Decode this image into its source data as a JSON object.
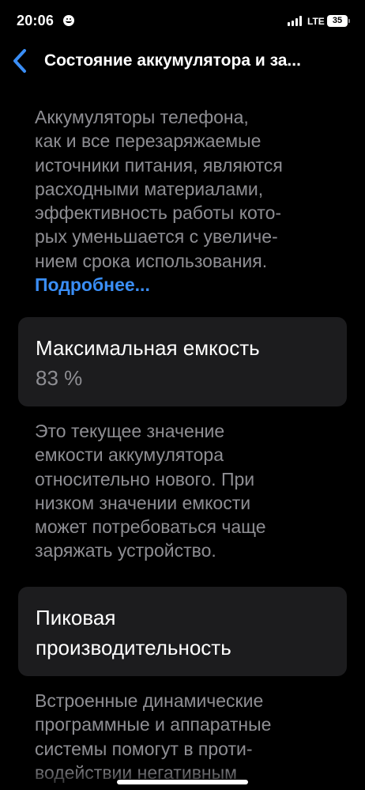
{
  "status_bar": {
    "time": "20:06",
    "network": "LTE",
    "battery_level": "35",
    "icons": [
      "focus-smiley-icon",
      "cellular-signal-icon",
      "battery-icon"
    ]
  },
  "nav": {
    "back_icon": "chevron-left-icon",
    "title": "Состояние аккумулятора и за..."
  },
  "intro": {
    "lines": [
      "Аккумуляторы телефона,",
      "как и все перезаряжаемые",
      "источники питания, являются",
      "расходными материалами,",
      "эффективность работы кото-",
      "рых уменьшается с увеличе-",
      "нием срока использования."
    ],
    "link": "Подробнее..."
  },
  "max_capacity": {
    "title": "Максимальная емкость",
    "value": "83 %",
    "description_lines": [
      "Это текущее значение",
      "емкости аккумулятора",
      "относительно нового. При",
      "низком значении емкости",
      "может потребоваться чаще",
      "заряжать устройство."
    ]
  },
  "peak_performance": {
    "title_lines": [
      "Пиковая",
      "производительность"
    ],
    "description_lines": [
      "Встроенные динамические",
      "программные и аппаратные",
      "системы помогут в проти-",
      "водействии негативным"
    ]
  },
  "colors": {
    "background": "#000000",
    "card": "#1c1c1e",
    "secondary_text": "#8e8e93",
    "link": "#3a8ef6"
  }
}
